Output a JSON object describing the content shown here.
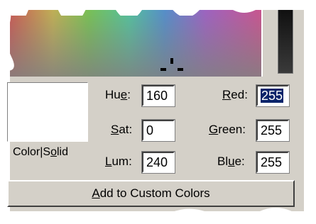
{
  "fields": {
    "hue": {
      "label_pre": "Hu",
      "label_ul": "e",
      "label_post": ":",
      "value": "160"
    },
    "sat": {
      "label_pre": "",
      "label_ul": "S",
      "label_post": "at:",
      "value": "0"
    },
    "lum": {
      "label_pre": "",
      "label_ul": "L",
      "label_post": "um:",
      "value": "240"
    },
    "red": {
      "label_pre": "",
      "label_ul": "R",
      "label_post": "ed:",
      "value": "255"
    },
    "green": {
      "label_pre": "",
      "label_ul": "G",
      "label_post": "reen:",
      "value": "255"
    },
    "blue": {
      "label_pre": "Bl",
      "label_ul": "u",
      "label_post": "e:",
      "value": "255"
    }
  },
  "color_solid": {
    "pre": "Color|S",
    "ul": "o",
    "post": "lid"
  },
  "add_button": {
    "pre": "",
    "ul": "A",
    "post": "dd to Custom Colors"
  },
  "colors": {
    "dialog_bg": "#d4d0c8",
    "selection_bg": "#0a246a",
    "current_color": "#ffffff"
  }
}
